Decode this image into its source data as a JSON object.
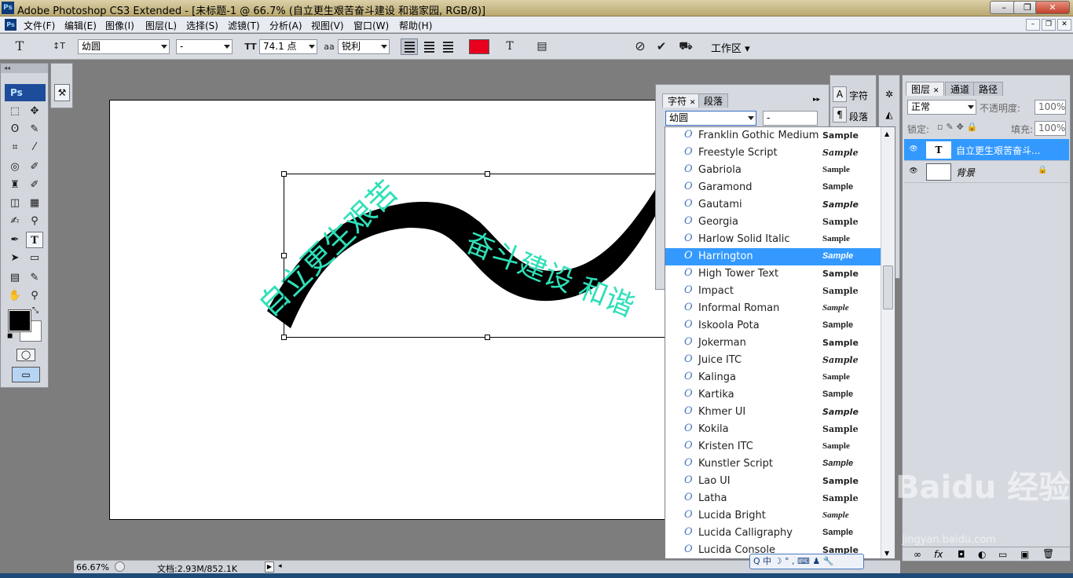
{
  "window": {
    "title": "Adobe Photoshop CS3 Extended - [未标题-1 @ 66.7% (自立更生艰苦奋斗建设 和谐家园, RGB/8)]",
    "logo": "Ps",
    "min": "–",
    "restore": "❐",
    "close": "✕"
  },
  "menu": {
    "logo": "Ps",
    "items": [
      "文件(F)",
      "编辑(E)",
      "图像(I)",
      "图层(L)",
      "选择(S)",
      "滤镜(T)",
      "分析(A)",
      "视图(V)",
      "窗口(W)",
      "帮助(H)"
    ],
    "doc_min": "–",
    "doc_restore": "❐",
    "doc_close": "✕"
  },
  "options": {
    "tool_icon": "T",
    "orient_icon": "↕T",
    "font_family": "幼圆",
    "font_style": "-",
    "size_icon": "TT",
    "font_size": "74.1 点",
    "aa_icon": "aa",
    "antialias": "锐利",
    "color": "#e8001c",
    "warp_icon": "T",
    "panel_icon": "▤",
    "cancel_icon": "⊘",
    "commit_icon": "✔",
    "bridge_icon": "⛟",
    "workspace": "工作区 ▾"
  },
  "toolbox": {
    "header": "◂◂",
    "logo": "Ps",
    "tools": [
      "⬚",
      "✥",
      "ʘ",
      "✎",
      "⌗",
      "⁄",
      "◎",
      "✐",
      "♜",
      "✐",
      "◫",
      "▦",
      "✍",
      "⚲",
      "✒",
      "T",
      "➤",
      "▭",
      "▤",
      "✎",
      "✋",
      "⚲"
    ],
    "quickmask": "◯",
    "screenmode": "▭",
    "swap": "⤡",
    "default": "◼"
  },
  "canvas": {
    "text_line1": "自立更生艰苦",
    "text_line2": "奋斗建设 和谐",
    "text_color": "#2ee0b8",
    "band_color": "#000000"
  },
  "status": {
    "zoom": "66.67%",
    "doc": "文档:2.93M/852.1K",
    "nav_arrow": "▶",
    "scroll_arrow": "◂"
  },
  "char_panel": {
    "tab1": "字符",
    "tab2": "段落",
    "close": "✕",
    "font_family": "幼圆",
    "font_style": "-",
    "menu": "▸▸",
    "dock_char": "字符",
    "dock_para": "段落"
  },
  "font_list": [
    {
      "name": "Franklin Gothic Medium",
      "sample": "Sample",
      "selected": false
    },
    {
      "name": "Freestyle Script",
      "sample": "Sample",
      "selected": false
    },
    {
      "name": "Gabriola",
      "sample": "Sample",
      "selected": false
    },
    {
      "name": "Garamond",
      "sample": "Sample",
      "selected": false
    },
    {
      "name": "Gautami",
      "sample": "Sample",
      "selected": false
    },
    {
      "name": "Georgia",
      "sample": "Sample",
      "selected": false
    },
    {
      "name": "Harlow Solid Italic",
      "sample": "Sample",
      "selected": false
    },
    {
      "name": "Harrington",
      "sample": "Sample",
      "selected": true
    },
    {
      "name": "High Tower Text",
      "sample": "Sample",
      "selected": false
    },
    {
      "name": "Impact",
      "sample": "Sample",
      "selected": false
    },
    {
      "name": "Informal Roman",
      "sample": "Sample",
      "selected": false
    },
    {
      "name": "Iskoola Pota",
      "sample": "Sample",
      "selected": false
    },
    {
      "name": "Jokerman",
      "sample": "Sample",
      "selected": false
    },
    {
      "name": "Juice ITC",
      "sample": "Sample",
      "selected": false
    },
    {
      "name": "Kalinga",
      "sample": "Sample",
      "selected": false
    },
    {
      "name": "Kartika",
      "sample": "Sample",
      "selected": false
    },
    {
      "name": "Khmer UI",
      "sample": "Sample",
      "selected": false
    },
    {
      "name": "Kokila",
      "sample": "Sample",
      "selected": false
    },
    {
      "name": "Kristen ITC",
      "sample": "Sample",
      "selected": false
    },
    {
      "name": "Kunstler Script",
      "sample": "Sample",
      "selected": false
    },
    {
      "name": "Lao UI",
      "sample": "Sample",
      "selected": false
    },
    {
      "name": "Latha",
      "sample": "Sample",
      "selected": false
    },
    {
      "name": "Lucida Bright",
      "sample": "Sample",
      "selected": false
    },
    {
      "name": "Lucida Calligraphy",
      "sample": "Sample",
      "selected": false
    },
    {
      "name": "Lucida Console",
      "sample": "Sample",
      "selected": false
    }
  ],
  "layers_panel": {
    "tabs": [
      "图层",
      "通道",
      "路径"
    ],
    "blend": "正常",
    "opacity_label": "不透明度:",
    "opacity": "100%",
    "lock_label": "锁定:",
    "fill_label": "填充:",
    "fill": "100%",
    "layers": [
      {
        "name": "自立更生艰苦奋斗...",
        "thumb": "T",
        "selected": true
      },
      {
        "name": "背景",
        "thumb": "",
        "selected": false
      }
    ],
    "footer_icons": [
      "∞",
      "fx",
      "◘",
      "◐",
      "▭",
      "▣",
      "🗑"
    ]
  },
  "ime": {
    "text": "Q 中 ☽ ° , ⌨ ♟ 🔧"
  },
  "watermark": {
    "text": "Baidu 经验",
    "url": "jingyan.baidu.com"
  }
}
